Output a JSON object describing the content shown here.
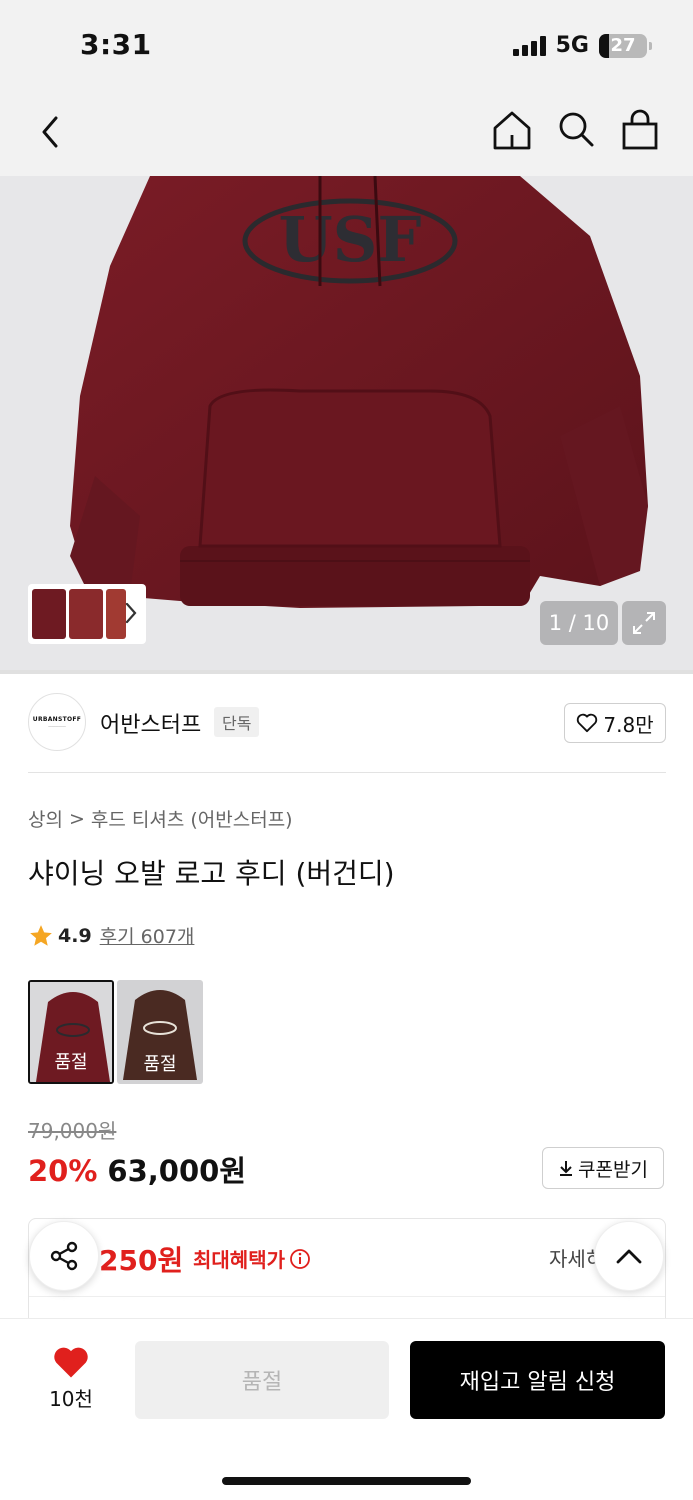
{
  "status_bar": {
    "time": "3:31",
    "network": "5G",
    "battery": "27"
  },
  "nav": {
    "icons": [
      "back-icon",
      "home-icon",
      "search-icon",
      "shopping-bag-icon"
    ]
  },
  "gallery": {
    "page_counter": "1 / 10",
    "current_page": 1,
    "total_pages": 10
  },
  "brand": {
    "logo_text": "URBANSTOFF",
    "name": "어반스터프",
    "tag": "단독",
    "likes": "7.8만"
  },
  "breadcrumb": {
    "category": "상의",
    "separator": ">",
    "subcategory": "후드 티셔츠 (어반스터프)"
  },
  "product": {
    "title": "샤이닝 오발 로고 후디 (버건디)",
    "rating": "4.9",
    "review_link": "후기 607개",
    "swatches": [
      {
        "label": "품절",
        "color": "#6e1a22"
      },
      {
        "label": "품절",
        "color": "#4a2a22"
      }
    ],
    "original_price": "79,000원",
    "discount": "20%",
    "sale_price": "63,000원",
    "coupon_label": "쿠폰받기"
  },
  "benefit": {
    "amount": "250원",
    "label": "최대혜택가",
    "detail": "자세히"
  },
  "bottom_bar": {
    "wish_count": "10천",
    "soldout_label": "품절",
    "restock_label": "재입고 알림 신청"
  },
  "colors": {
    "accent_red": "#e0201d",
    "product_burgundy": "#6e1a22",
    "cta_black": "#000000"
  }
}
